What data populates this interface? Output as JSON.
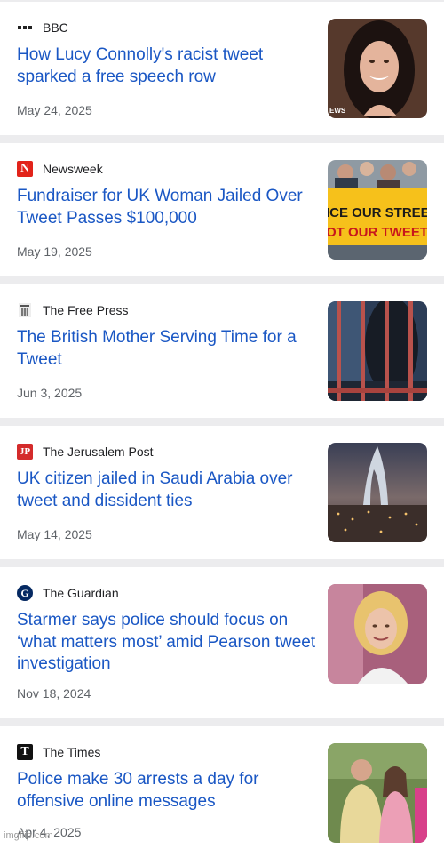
{
  "articles": [
    {
      "source": "BBC",
      "logo_icon": "bbc-blocks-icon",
      "headline": "How Lucy Connolly's racist tweet sparked a free speech row",
      "date": "May 24, 2025",
      "thumb_caption": "EWS"
    },
    {
      "source": "Newsweek",
      "logo_icon": "newsweek-n-icon",
      "logo_text": "N",
      "logo_color": "#e2231a",
      "headline": "Fundraiser for UK Woman Jailed Over Tweet Passes $100,000",
      "date": "May 19, 2025",
      "banner_line1": "ICE OUR STREE",
      "banner_line2": "OT OUR TWEETS"
    },
    {
      "source": "The Free Press",
      "logo_icon": "free-press-logo-icon",
      "headline": "The British Mother Serving Time for a Tweet",
      "date": "Jun 3, 2025"
    },
    {
      "source": "The Jerusalem Post",
      "logo_icon": "jerusalem-post-jp-icon",
      "logo_text": "JP",
      "logo_color": "#d42b2b",
      "headline": "UK citizen jailed in Saudi Arabia over tweet and dissident ties",
      "date": "May 14, 2025"
    },
    {
      "source": "The Guardian",
      "logo_icon": "guardian-g-icon",
      "logo_text": "G",
      "logo_color": "#052962",
      "headline": "Starmer says police should focus on ‘what matters most’ amid Pearson tweet investigation",
      "date": "Nov 18, 2024"
    },
    {
      "source": "The Times",
      "logo_icon": "times-t-icon",
      "logo_text": "T",
      "headline": "Police make 30 arrests a day for offensive online messages",
      "date": "Apr 4, 2025"
    }
  ],
  "watermark": "imgflip.com"
}
